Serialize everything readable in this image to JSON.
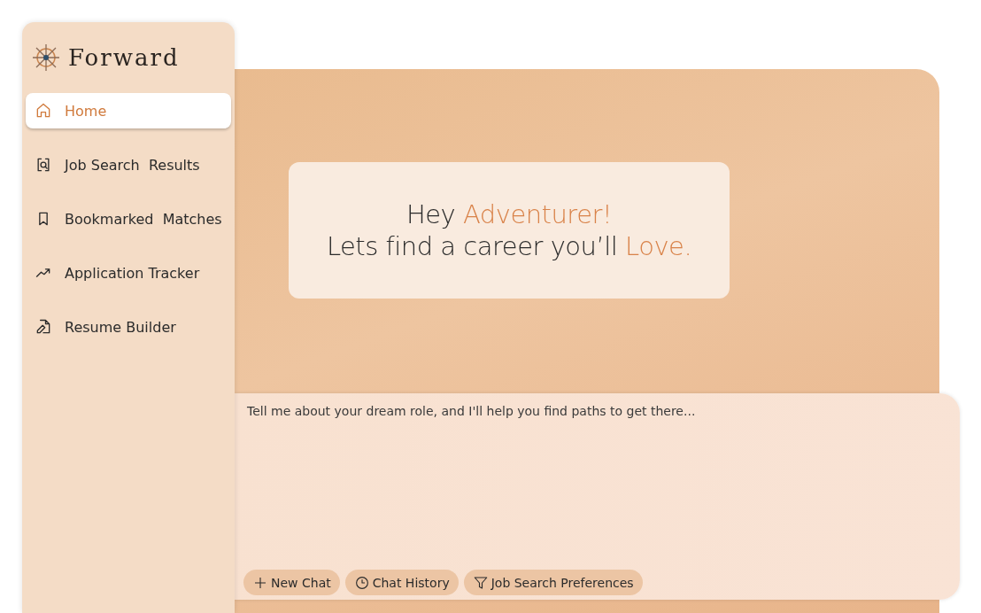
{
  "sidebar": {
    "brand": "Forward",
    "items": [
      {
        "label": "Home",
        "selected": true
      },
      {
        "label": "Job Search  Results",
        "selected": false
      },
      {
        "label": "Bookmarked  Matches",
        "selected": false
      },
      {
        "label": "Application Tracker",
        "selected": false
      },
      {
        "label": "Resume Builder",
        "selected": false
      }
    ]
  },
  "greeting": {
    "lines": [
      [
        {
          "text": "Hey ",
          "accent": false
        },
        {
          "text": "Adventurer!",
          "accent": true
        }
      ],
      [
        {
          "text": "Lets find a career you’ll ",
          "accent": false
        },
        {
          "text": "Love.",
          "accent": true
        }
      ]
    ]
  },
  "chat": {
    "placeholder": "Tell me about your dream role, and I'll help you find paths to get there...",
    "buttons": [
      "New Chat",
      "Chat History",
      "Job Search Preferences"
    ]
  }
}
